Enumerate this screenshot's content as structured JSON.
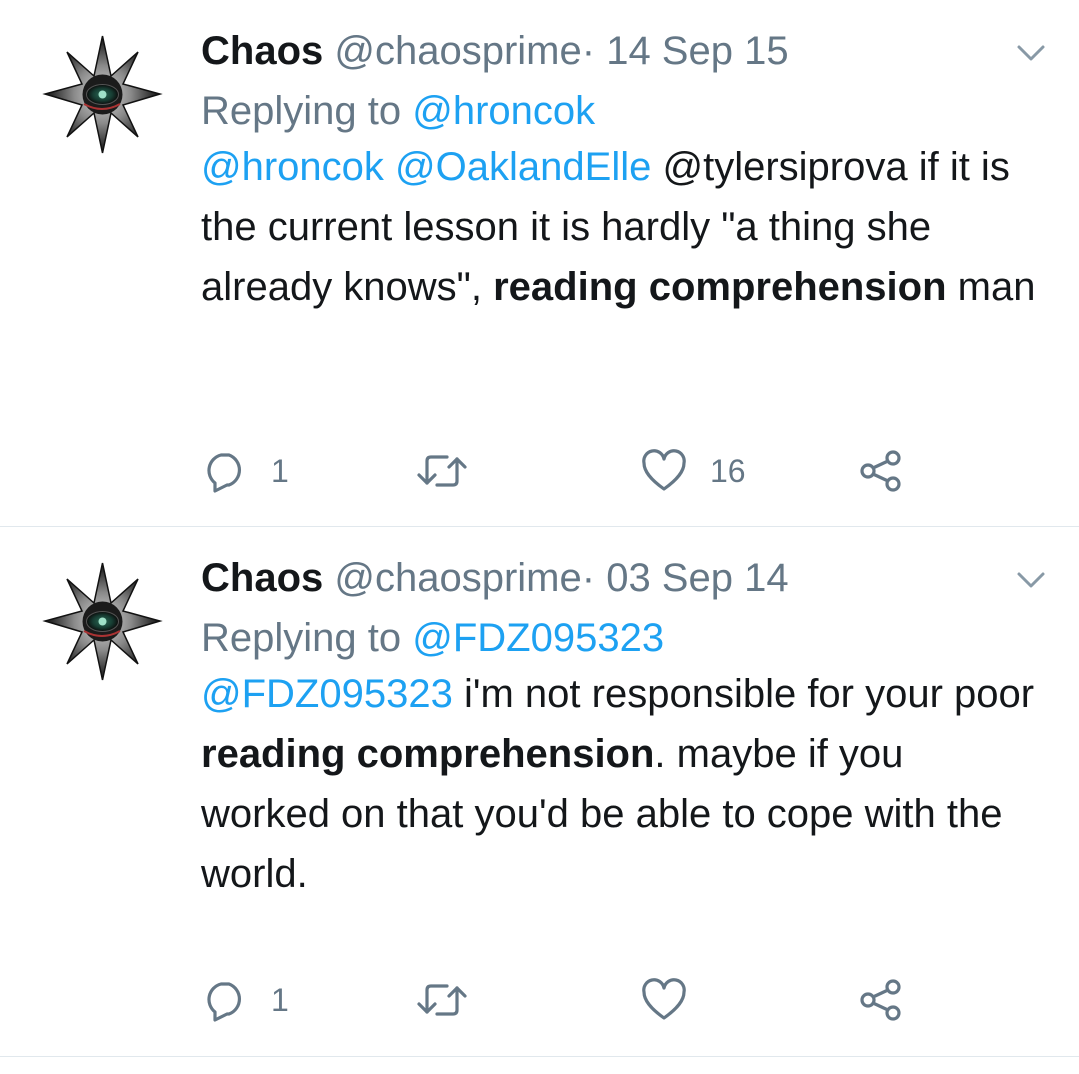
{
  "colors": {
    "text": "#14171a",
    "secondary": "#657786",
    "link": "#1da1f2",
    "divider": "#e1e8ed"
  },
  "tweets": [
    {
      "name": "Chaos",
      "handle": "@chaosprime",
      "separator": "·",
      "date": "14 Sep 15",
      "replying_prefix": "Replying to",
      "replying_to": "@hroncok",
      "body": {
        "m1": "@hroncok",
        "m2": "@OaklandElle",
        "t1": "@tylersiprova if it is the current lesson it is hardly \"a thing she already knows\", ",
        "b1": "reading comprehension",
        "t2": " man"
      },
      "reply_count": "1",
      "retweet_count": "",
      "like_count": "16",
      "icons": [
        "reply-icon",
        "retweet-icon",
        "heart-icon",
        "share-icon",
        "chevron-down-icon"
      ]
    },
    {
      "name": "Chaos",
      "handle": "@chaosprime",
      "separator": "·",
      "date": "03 Sep 14",
      "replying_prefix": "Replying to",
      "replying_to": "@FDZ095323",
      "body": {
        "m1": "@FDZ095323",
        "t1": " i'm not responsible for your poor ",
        "b1": "reading comprehension",
        "t2": ". maybe if you worked on that you'd be able to cope with the world."
      },
      "reply_count": "1",
      "retweet_count": "",
      "like_count": "",
      "icons": [
        "reply-icon",
        "retweet-icon",
        "heart-icon",
        "share-icon",
        "chevron-down-icon"
      ]
    }
  ]
}
